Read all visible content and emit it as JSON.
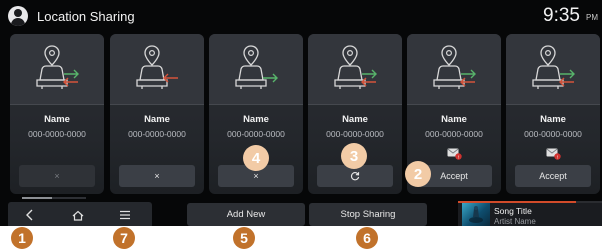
{
  "status_bar": {
    "title": "Location Sharing",
    "time": "9:35",
    "ampm": "PM",
    "icons": {
      "profile": "person-icon"
    }
  },
  "cards": [
    {
      "name": "Name",
      "phone": "000-0000-0000",
      "action": "×",
      "action_icon": "close-icon",
      "arrow": "incoming",
      "message_badge": false,
      "disabled": true
    },
    {
      "name": "Name",
      "phone": "000-0000-0000",
      "action": "×",
      "action_icon": "close-icon",
      "arrow": "incoming",
      "message_badge": false,
      "disabled": false
    },
    {
      "name": "Name",
      "phone": "000-0000-0000",
      "action": "×",
      "action_icon": "close-icon",
      "arrow": "outgoing",
      "message_badge": false,
      "disabled": false
    },
    {
      "name": "Name",
      "phone": "000-0000-0000",
      "action": "",
      "action_icon": "refresh-icon",
      "arrow": "both",
      "message_badge": false,
      "disabled": false
    },
    {
      "name": "Name",
      "phone": "000-0000-0000",
      "action": "Accept",
      "action_icon": "",
      "arrow": "both",
      "message_badge": true,
      "disabled": false
    },
    {
      "name": "Name",
      "phone": "000-0000-0000",
      "action": "Accept",
      "action_icon": "",
      "arrow": "both",
      "message_badge": true,
      "disabled": false
    }
  ],
  "bottom_bar": {
    "nav_icons": [
      "back-icon",
      "home-icon",
      "menu-icon"
    ],
    "add_new": "Add New",
    "stop_sharing": "Stop Sharing",
    "media": {
      "song_title": "Song Title",
      "artist": "Artist Name",
      "progress": 0.82
    }
  },
  "callouts": [
    "1",
    "2",
    "3",
    "4",
    "5",
    "6",
    "7"
  ],
  "colors": {
    "background": "#060708",
    "card": "#2a2d32",
    "incoming_arrow": "#d5533b",
    "outgoing_arrow": "#58b46b",
    "badge_red": "#d0322f",
    "callout_light": "#f2cba6",
    "callout_dark": "#c1722b"
  }
}
